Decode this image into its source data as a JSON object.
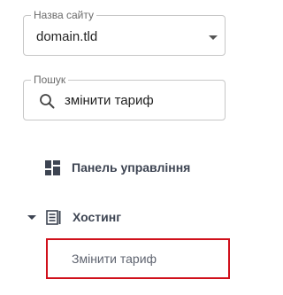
{
  "site_selector": {
    "label": "Назва сайту",
    "value": "domain.tld"
  },
  "search": {
    "label": "Пошук",
    "value": "змінити тариф"
  },
  "nav": {
    "dashboard_label": "Панель управління",
    "hosting_label": "Хостинг",
    "hosting_items": [
      {
        "label": "Змінити тариф"
      }
    ]
  },
  "colors": {
    "highlight_border": "#d0101b",
    "nav_text": "#3d4452"
  },
  "icons": {
    "dashboard": "dashboard-grid-icon",
    "hosting": "server-list-icon",
    "search": "search-icon",
    "expand": "caret-down-icon"
  }
}
